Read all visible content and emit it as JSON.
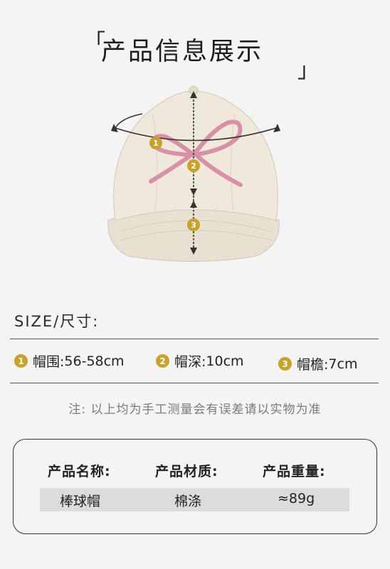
{
  "header": {
    "open_bracket": "「",
    "title": "产品信息展示",
    "close_bracket": "」"
  },
  "diagram": {
    "marker1": "1",
    "marker2": "2",
    "marker3": "3"
  },
  "size_section": {
    "title": "SIZE/尺寸:",
    "specs": [
      {
        "num": "1",
        "label": "帽围:",
        "value": "56-58cm"
      },
      {
        "num": "2",
        "label": "帽深:",
        "value": "10cm"
      },
      {
        "num": "3",
        "label": "帽檐:",
        "value": "7cm"
      }
    ],
    "note": "注:  以上均为手工测量会有误差请以实物为准"
  },
  "product_info": {
    "headers": [
      "产品名称:",
      "产品材质:",
      "产品重量:"
    ],
    "values": [
      "棒球帽",
      "棉涤",
      "≈89g"
    ]
  },
  "colors": {
    "badge": "#c9a227",
    "hat": "#ece6d8",
    "bow": "#d98fa6",
    "background": "#f4f4f4"
  }
}
